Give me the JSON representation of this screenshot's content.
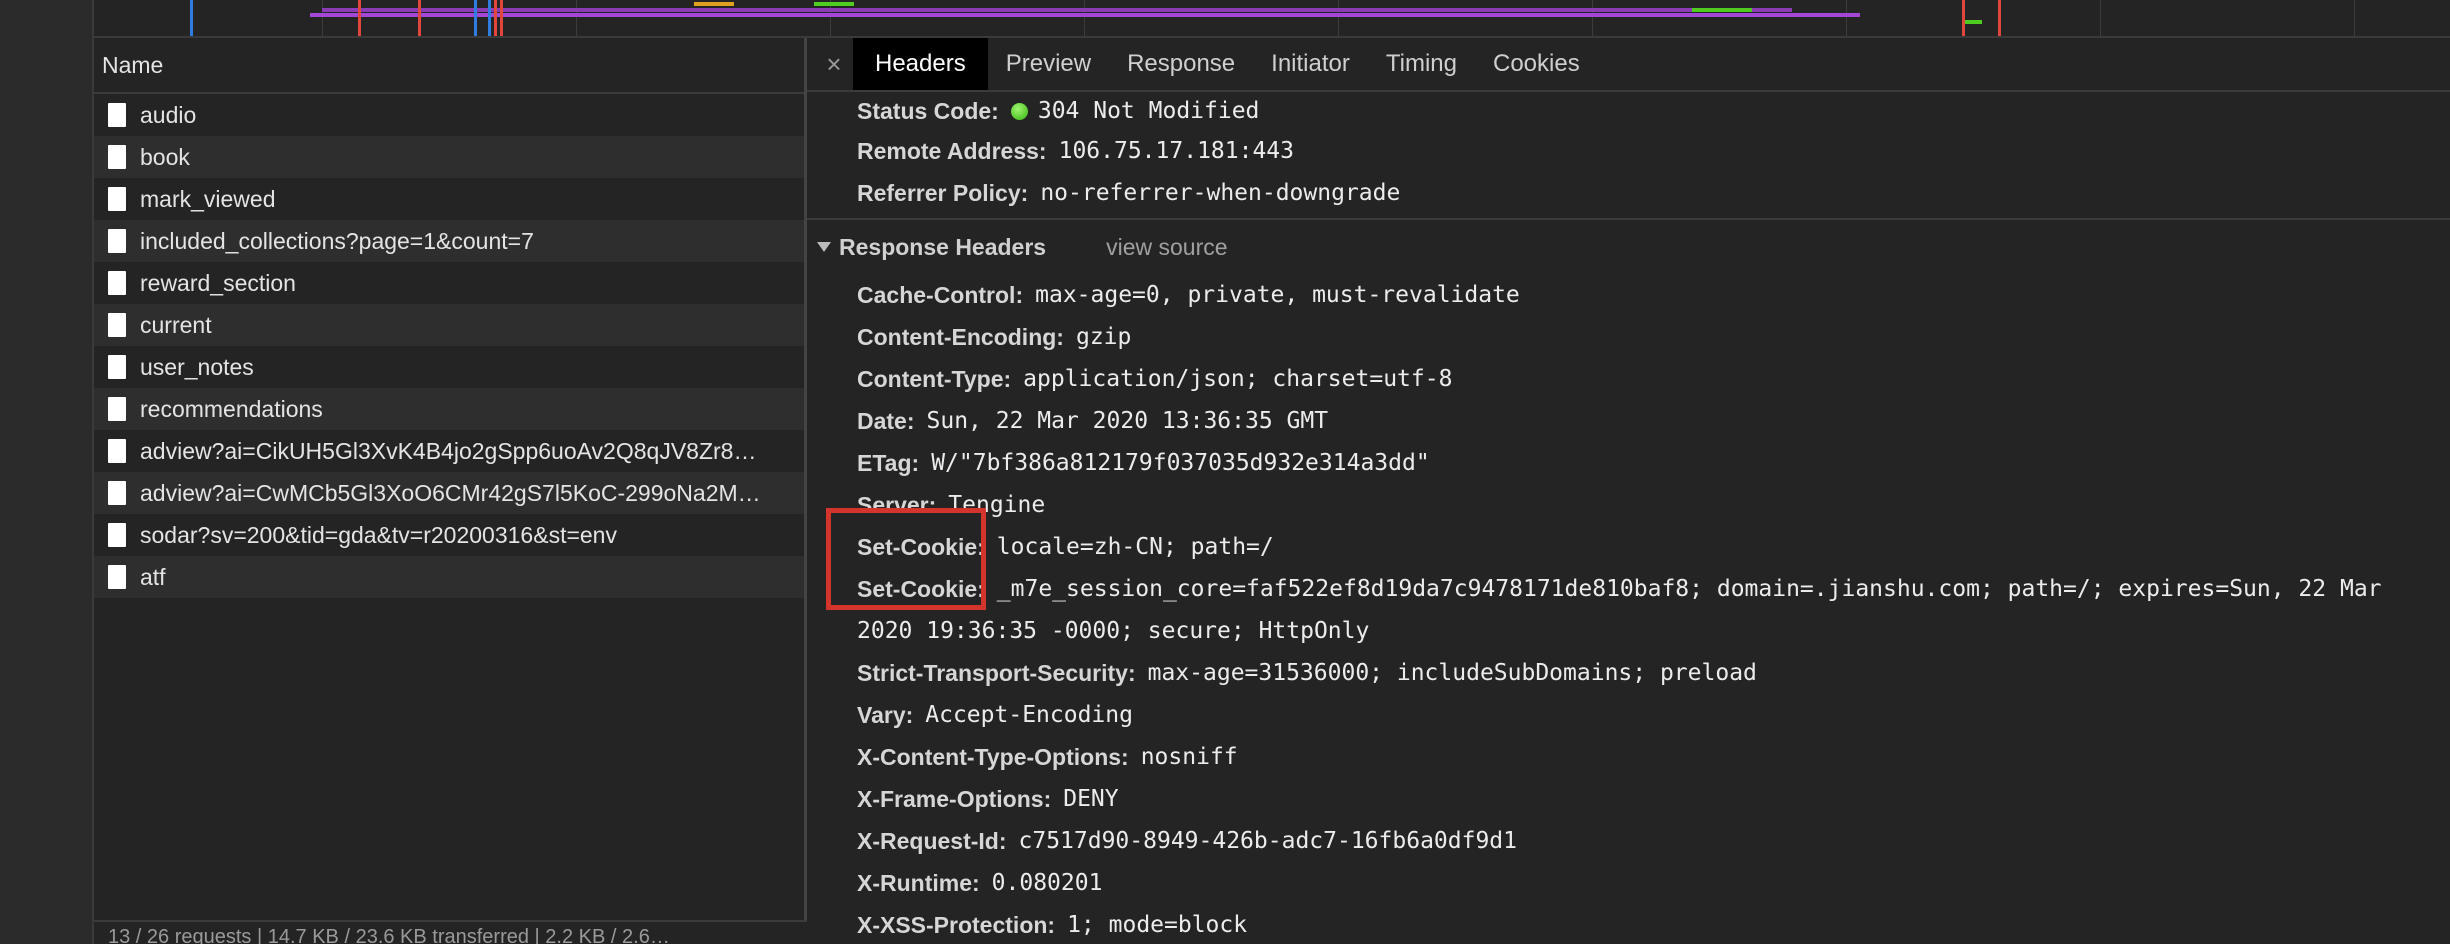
{
  "colors": {
    "accent_highlight": "#d3342c",
    "status_dot": "#4fcc20",
    "active_tab_bg": "#000000"
  },
  "name_column": {
    "header": "Name"
  },
  "requests": [
    "audio",
    "book",
    "mark_viewed",
    "included_collections?page=1&count=7",
    "reward_section",
    "current",
    "user_notes",
    "recommendations",
    "adview?ai=CikUH5Gl3XvK4B4jo2gSpp6uoAv2Q8qJV8Zr8…",
    "adview?ai=CwMCb5Gl3XoO6CMr42gS7l5KoC-299oNa2M…",
    "sodar?sv=200&tid=gda&tv=r20200316&st=env",
    "atf"
  ],
  "tabs": {
    "close": "×",
    "headers": "Headers",
    "preview": "Preview",
    "response": "Response",
    "initiator": "Initiator",
    "timing": "Timing",
    "cookies": "Cookies"
  },
  "general": {
    "status_code_key": "Status Code:",
    "status_code_val": "304 Not Modified",
    "remote_address_key": "Remote Address:",
    "remote_address_val": "106.75.17.181:443",
    "referrer_policy_key": "Referrer Policy:",
    "referrer_policy_val": "no-referrer-when-downgrade"
  },
  "response_headers": {
    "title": "Response Headers",
    "view_source": "view source",
    "items": [
      {
        "k": "Cache-Control:",
        "v": "max-age=0, private, must-revalidate"
      },
      {
        "k": "Content-Encoding:",
        "v": "gzip"
      },
      {
        "k": "Content-Type:",
        "v": "application/json; charset=utf-8"
      },
      {
        "k": "Date:",
        "v": "Sun, 22 Mar 2020 13:36:35 GMT"
      },
      {
        "k": "ETag:",
        "v": "W/\"7bf386a812179f037035d932e314a3dd\""
      },
      {
        "k": "Server:",
        "v": "Tengine"
      },
      {
        "k": "Set-Cookie:",
        "v": "locale=zh-CN; path=/"
      },
      {
        "k": "Set-Cookie:",
        "v": "_m7e_session_core=faf522ef8d19da7c9478171de810baf8; domain=.jianshu.com; path=/; expires=Sun, 22 Mar"
      }
    ],
    "wrap_text": "2020 19:36:35 -0000; secure; HttpOnly",
    "items2": [
      {
        "k": "Strict-Transport-Security:",
        "v": "max-age=31536000; includeSubDomains; preload"
      },
      {
        "k": "Vary:",
        "v": "Accept-Encoding"
      },
      {
        "k": "X-Content-Type-Options:",
        "v": "nosniff"
      },
      {
        "k": "X-Frame-Options:",
        "v": "DENY"
      },
      {
        "k": "X-Request-Id:",
        "v": "c7517d90-8949-426b-adc7-16fb6a0df9d1"
      },
      {
        "k": "X-Runtime:",
        "v": "0.080201"
      },
      {
        "k": "X-XSS-Protection:",
        "v": "1; mode=block"
      }
    ]
  },
  "statusbar": {
    "text": "13 / 26 requests  |  14.7 KB / 23.6 KB transferred  |  2.2 KB / 2.6…"
  }
}
